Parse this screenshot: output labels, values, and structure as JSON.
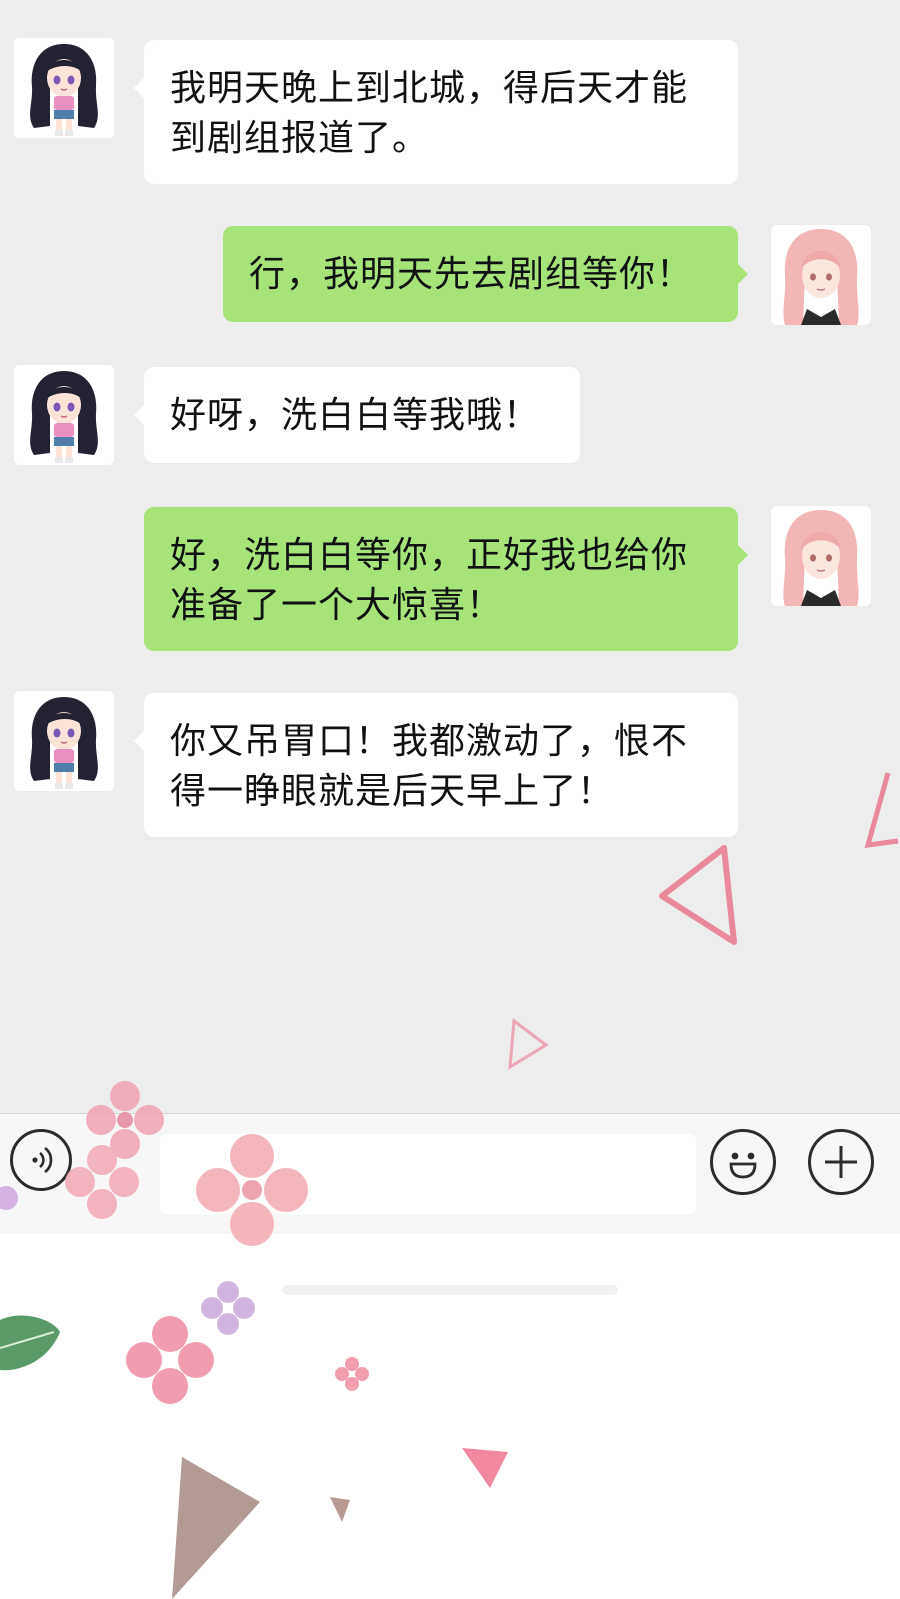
{
  "messages": [
    {
      "side": "left",
      "avatar": "dark-hair-girl-avatar",
      "text": "我明天晚上到北城，得后天才能\n到剧组报道了。"
    },
    {
      "side": "right",
      "avatar": "pink-hair-girl-avatar",
      "text": "行，我明天先去剧组等你！"
    },
    {
      "side": "left",
      "avatar": "dark-hair-girl-avatar",
      "text": "好呀，洗白白等我哦！"
    },
    {
      "side": "right",
      "avatar": "pink-hair-girl-avatar",
      "text": "好，洗白白等你，正好我也给你\n准备了一个大惊喜！"
    },
    {
      "side": "left",
      "avatar": "dark-hair-girl-avatar",
      "text": "你又吊胃口！我都激动了，恨不\n得一睁眼就是后天早上了！"
    }
  ],
  "input_bar": {
    "voice_icon": "voice-icon",
    "emoji_icon": "emoji-icon",
    "plus_icon": "plus-icon",
    "input_value": ""
  },
  "colors": {
    "chat_bg": "#ededed",
    "bubble_left": "#ffffff",
    "bubble_right": "#a6e47a",
    "input_bar_bg": "#f7f7f7"
  }
}
